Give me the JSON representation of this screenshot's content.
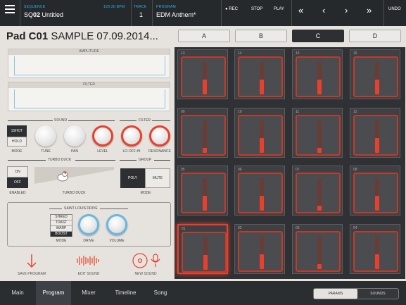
{
  "top": {
    "sequence_label": "SEQUENCE",
    "sequence_prefix": "SQ",
    "sequence_num": "02",
    "sequence_name": "Untitled",
    "time": "120:30 BPM",
    "track_label": "TRACK",
    "track_value": "1",
    "program_label": "PROGRAM",
    "program_value": "EDM Anthem*",
    "rec": "REC",
    "stop": "STOP",
    "play": "PLAY",
    "undo": "UNDO"
  },
  "pad": {
    "prefix": "Pad C01",
    "sample": "SAMPLE 07.09.2014..."
  },
  "banks": [
    "A",
    "B",
    "C",
    "D"
  ],
  "active_bank": "C",
  "envelopes": {
    "amplitude": "AMPLITUDE",
    "filter": "FILTER"
  },
  "sound": {
    "title": "SOUND",
    "mode_on": "1SHOT",
    "mode_off": "HOLD",
    "mode": "MODE",
    "tune": "TUNE",
    "pan": "PAN",
    "level": "LEVEL"
  },
  "filter": {
    "title": "FILTER",
    "type": "LO-OFF-HI",
    "resonance": "RESONANCE"
  },
  "turbo": {
    "title": "TURBO DUCK",
    "on": "ON",
    "off": "OFF",
    "enabled": "ENABLED",
    "label": "TURBO DUCK"
  },
  "group": {
    "title": "GROUP",
    "poly": "POLY",
    "mute": "MUTE",
    "mode": "MODE"
  },
  "drive": {
    "title": "SAINT LOUIS DRIVE",
    "modes": [
      "SHRED",
      "TOAST",
      "WARP",
      "BOOST"
    ],
    "mode": "MODE",
    "drive": "DRIVE",
    "volume": "VOLUME"
  },
  "actions": {
    "save": "SAVE PROGRAM",
    "edit": "EDIT SOUND",
    "new": "NEW SOUND"
  },
  "pads": [
    {
      "n": "13",
      "level": 0.45
    },
    {
      "n": "14",
      "level": 0.45
    },
    {
      "n": "15",
      "level": 0.45
    },
    {
      "n": "16",
      "level": 0.45
    },
    {
      "n": "09",
      "level": 0.15
    },
    {
      "n": "10",
      "level": 0.45
    },
    {
      "n": "11",
      "level": 0.15
    },
    {
      "n": "12",
      "level": 0.45
    },
    {
      "n": "05",
      "level": 0.45
    },
    {
      "n": "06",
      "level": 0.45
    },
    {
      "n": "07",
      "level": 0.15
    },
    {
      "n": "08",
      "level": 0.45
    },
    {
      "n": "01",
      "level": 0.45
    },
    {
      "n": "02",
      "level": 0.45
    },
    {
      "n": "03",
      "level": 0.15
    },
    {
      "n": "04",
      "level": 0.45
    }
  ],
  "nav": [
    "Main",
    "Program",
    "Mixer",
    "Timeline",
    "Song"
  ],
  "active_nav": "Program",
  "params_tab": "PARAMS",
  "sounds_tab": "SOUNDS",
  "colors": {
    "accent": "#e8402c",
    "blue": "#2ab3e8"
  }
}
